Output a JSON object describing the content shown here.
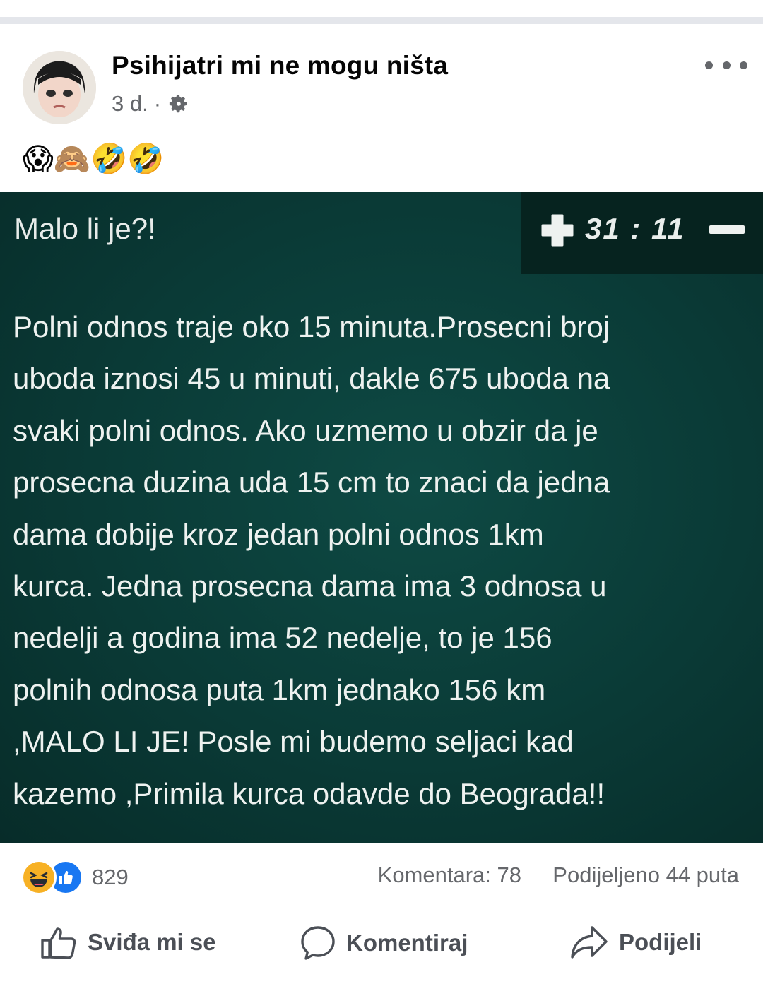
{
  "post": {
    "page_name": "Psihijatri mi ne mogu ništa",
    "time": "3 d.",
    "separator": "·",
    "privacy_icon": "gear-icon",
    "caption_emojis": "😱🙈🤣🤣"
  },
  "image": {
    "title": "Malo li je?!",
    "score": "31 : 11",
    "body": "Polni odnos traje oko 15 minuta.Prosecni broj\nuboda iznosi 45 u minuti, dakle 675 uboda na\nsvaki polni odnos. Ako uzmemo u obzir da je\nprosecna duzina uda 15 cm to znaci da jedna\ndama dobije kroz jedan polni odnos 1km\nkurca. Jedna prosecna dama ima 3 odnosa u\nnedelji a godina ima 52 nedelje, to je 156\npolnih odnosa puta 1km jednako 156 km\n,MALO LI JE! Posle mi budemo seljaci kad\nkazemo ,Primila kurca odavde do Beograda!!"
  },
  "stats": {
    "reaction_count": "829",
    "comments": "Komentara: 78",
    "shares": "Podijeljeno 44 puta"
  },
  "actions": {
    "like": "Sviđa mi se",
    "comment": "Komentiraj",
    "share": "Podijeli"
  },
  "colors": {
    "image_bg": "#0a3a36",
    "like_blue": "#1877f2",
    "haha_yellow": "#f7b125",
    "meta_gray": "#65676b"
  }
}
